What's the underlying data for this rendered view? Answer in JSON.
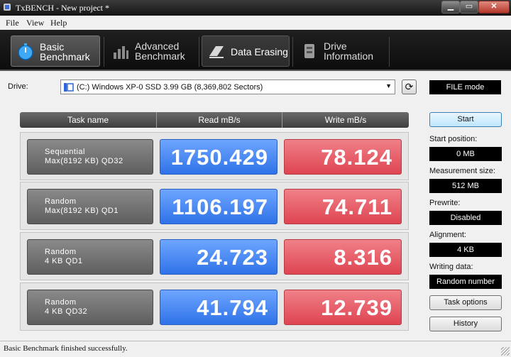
{
  "window": {
    "title": "TxBENCH - New project *"
  },
  "menu": [
    "File",
    "View",
    "Help"
  ],
  "tabs": [
    {
      "label": "Basic\nBenchmark",
      "icon": "stopwatch-icon",
      "active": true
    },
    {
      "label": "Advanced\nBenchmark",
      "icon": "bar-chart-icon",
      "active": false
    },
    {
      "label": "Data Erasing",
      "icon": "eraser-icon",
      "active": false
    },
    {
      "label": "Drive\nInformation",
      "icon": "drive-info-icon",
      "active": false
    }
  ],
  "drive": {
    "label": "Drive:",
    "selected": "(C:) Windows XP-0 SSD  3.99 GB (8,369,802 Sectors)",
    "mode": "FILE mode"
  },
  "table": {
    "headers": [
      "Task name",
      "Read mB/s",
      "Write mB/s"
    ],
    "rows": [
      {
        "task": "Sequential\nMax(8192 KB) QD32",
        "read": "1750.429",
        "write": "78.124"
      },
      {
        "task": "Random\nMax(8192 KB) QD1",
        "read": "1106.197",
        "write": "74.711"
      },
      {
        "task": "Random\n4 KB QD1",
        "read": "24.723",
        "write": "8.316"
      },
      {
        "task": "Random\n4 KB QD32",
        "read": "41.794",
        "write": "12.739"
      }
    ]
  },
  "panel": {
    "start": "Start",
    "start_position_label": "Start position:",
    "start_position": "0 MB",
    "measurement_size_label": "Measurement size:",
    "measurement_size": "512 MB",
    "prewrite_label": "Prewrite:",
    "prewrite": "Disabled",
    "alignment_label": "Alignment:",
    "alignment": "4 KB",
    "writing_data_label": "Writing data:",
    "writing_data": "Random number",
    "task_options": "Task options",
    "history": "History"
  },
  "status": "Basic Benchmark finished successfully.",
  "colors": {
    "read": "#2f72e8",
    "write": "#de4451",
    "toolbar": "#151515"
  }
}
